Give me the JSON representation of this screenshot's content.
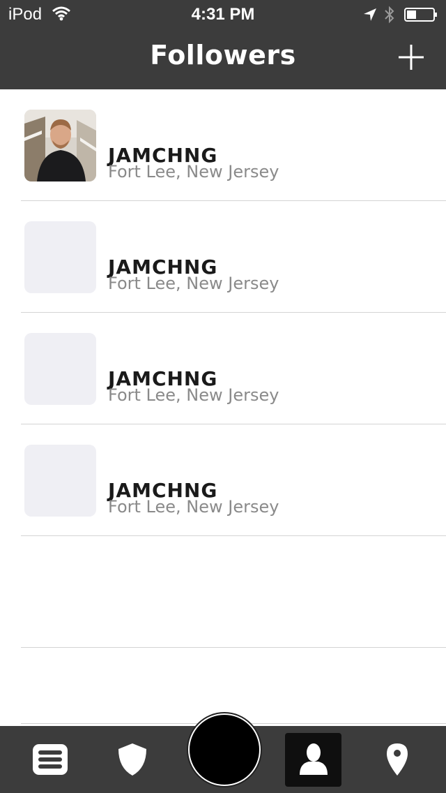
{
  "status_bar": {
    "carrier": "iPod",
    "time": "4:31 PM",
    "icons": [
      "wifi-icon",
      "location-arrow-icon",
      "bluetooth-icon",
      "battery-icon"
    ]
  },
  "nav": {
    "title": "Followers",
    "add_icon": "plus-icon"
  },
  "followers": [
    {
      "name": "JAMCHNG",
      "location": "Fort Lee, New Jersey",
      "has_photo": true
    },
    {
      "name": "JAMCHNG",
      "location": "Fort Lee, New Jersey",
      "has_photo": false
    },
    {
      "name": "JAMCHNG",
      "location": "Fort Lee, New Jersey",
      "has_photo": false
    },
    {
      "name": "JAMCHNG",
      "location": "Fort Lee, New Jersey",
      "has_photo": false
    }
  ],
  "tab_bar": {
    "tabs": [
      {
        "icon": "menu-list-icon",
        "active": false
      },
      {
        "icon": "shield-icon",
        "active": false
      },
      {
        "icon": "center-action-icon",
        "active": false
      },
      {
        "icon": "person-icon",
        "active": true
      },
      {
        "icon": "map-pin-icon",
        "active": false
      }
    ]
  },
  "colors": {
    "bar_bg": "#3c3c3c",
    "placeholder": "#efeff4",
    "name_text": "#1a1a1a",
    "location_text": "#8a8a8a",
    "active_tab_bg": "#0f0f0f"
  }
}
